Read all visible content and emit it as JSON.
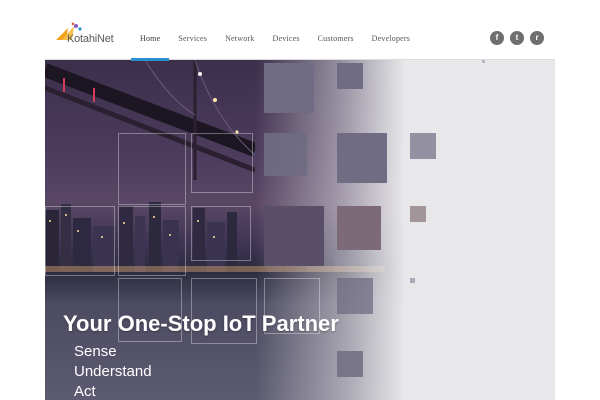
{
  "brand": {
    "name": "KotahiNet"
  },
  "nav": {
    "items": [
      {
        "label": "Home",
        "active": true
      },
      {
        "label": "Services",
        "active": false
      },
      {
        "label": "Network",
        "active": false
      },
      {
        "label": "Devices",
        "active": false
      },
      {
        "label": "Customers",
        "active": false
      },
      {
        "label": "Developers",
        "active": false
      }
    ]
  },
  "social": [
    {
      "icon": "facebook-icon",
      "glyph": "f"
    },
    {
      "icon": "twitter-icon",
      "glyph": "t"
    },
    {
      "icon": "rss-icon",
      "glyph": "r"
    }
  ],
  "hero": {
    "title": "Your One-Stop IoT Partner",
    "lines": [
      "Sense",
      "Understand",
      "Act"
    ]
  },
  "colors": {
    "accent": "#2a8fd0",
    "header_bg": "#ffffff",
    "page_bg": "#e8e8ea",
    "tile": "#706c84"
  }
}
